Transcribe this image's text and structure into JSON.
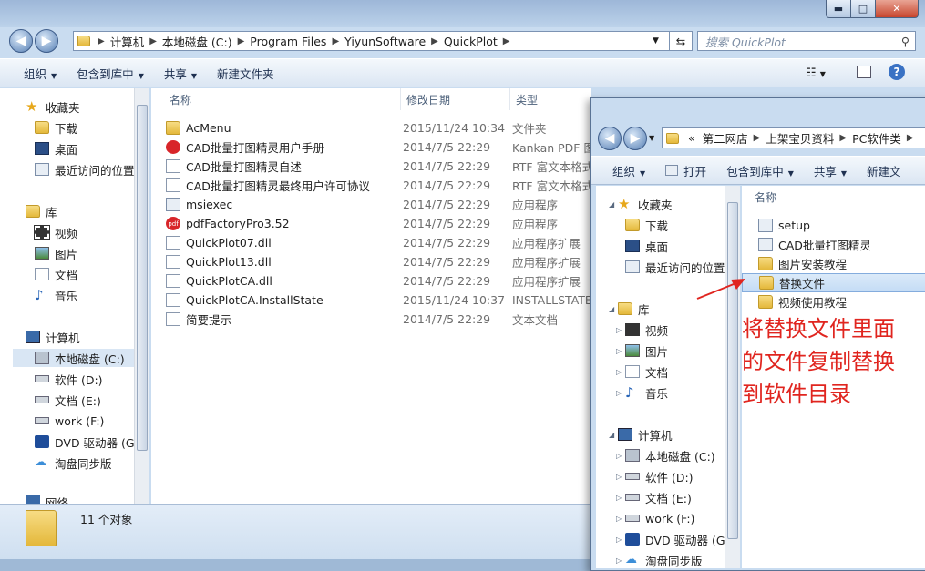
{
  "window1": {
    "title_controls": {
      "minimize": "▬",
      "maximize": "□",
      "close": "✕"
    },
    "address": [
      "计算机",
      "本地磁盘 (C:)",
      "Program Files",
      "YiyunSoftware",
      "QuickPlot"
    ],
    "search_placeholder": "搜索 QuickPlot",
    "toolbar": [
      "组织",
      "包含到库中",
      "共享",
      "新建文件夹"
    ],
    "nav": {
      "favorites": "收藏夹",
      "fav_items": [
        "下载",
        "桌面",
        "最近访问的位置"
      ],
      "library": "库",
      "lib_items": [
        "视频",
        "图片",
        "文档",
        "音乐"
      ],
      "computer": "计算机",
      "drives": [
        "本地磁盘 (C:)",
        "软件 (D:)",
        "文档 (E:)",
        "work (F:)",
        "DVD 驱动器 (G:)",
        "淘盘同步版"
      ],
      "network": "网络"
    },
    "columns": [
      "名称",
      "修改日期",
      "类型"
    ],
    "files": [
      {
        "name": "AcMenu",
        "date": "2015/11/24 10:34",
        "type": "文件夹",
        "icon": "folder"
      },
      {
        "name": "CAD批量打图精灵用户手册",
        "date": "2014/7/5 22:29",
        "type": "Kankan PDF 图",
        "icon": "pdf-doc"
      },
      {
        "name": "CAD批量打图精灵自述",
        "date": "2014/7/5 22:29",
        "type": "RTF 富文本格式",
        "icon": "rtf"
      },
      {
        "name": "CAD批量打图精灵最终用户许可协议",
        "date": "2014/7/5 22:29",
        "type": "RTF 富文本格式",
        "icon": "rtf"
      },
      {
        "name": "msiexec",
        "date": "2014/7/5 22:29",
        "type": "应用程序",
        "icon": "exe"
      },
      {
        "name": "pdfFactoryPro3.52",
        "date": "2014/7/5 22:29",
        "type": "应用程序",
        "icon": "pdf"
      },
      {
        "name": "QuickPlot07.dll",
        "date": "2014/7/5 22:29",
        "type": "应用程序扩展",
        "icon": "dll"
      },
      {
        "name": "QuickPlot13.dll",
        "date": "2014/7/5 22:29",
        "type": "应用程序扩展",
        "icon": "dll"
      },
      {
        "name": "QuickPlotCA.dll",
        "date": "2014/7/5 22:29",
        "type": "应用程序扩展",
        "icon": "dll"
      },
      {
        "name": "QuickPlotCA.InstallState",
        "date": "2015/11/24 10:37",
        "type": "INSTALLSTATE",
        "icon": "file"
      },
      {
        "name": "简要提示",
        "date": "2014/7/5 22:29",
        "type": "文本文档",
        "icon": "txt"
      }
    ],
    "status": "11 个对象"
  },
  "window2": {
    "address": [
      "第二网店",
      "上架宝贝资料",
      "PC软件类"
    ],
    "address_prefix": "«",
    "toolbar": [
      "组织",
      "打开",
      "包含到库中",
      "共享",
      "新建文"
    ],
    "nav": {
      "favorites": "收藏夹",
      "fav_items": [
        "下载",
        "桌面",
        "最近访问的位置"
      ],
      "library": "库",
      "lib_items": [
        "视频",
        "图片",
        "文档",
        "音乐"
      ],
      "computer": "计算机",
      "drives": [
        "本地磁盘 (C:)",
        "软件 (D:)",
        "文档 (E:)",
        "work (F:)",
        "DVD 驱动器 (G:)",
        "淘盘同步版"
      ]
    },
    "column": "名称",
    "files": [
      {
        "name": "setup",
        "icon": "setup"
      },
      {
        "name": "CAD批量打图精灵",
        "icon": "exe"
      },
      {
        "name": "图片安装教程",
        "icon": "folder"
      },
      {
        "name": "替换文件",
        "icon": "folder",
        "selected": true
      },
      {
        "name": "视频使用教程",
        "icon": "folder"
      }
    ]
  },
  "annotation": "将替换文件里面\n的文件复制替换\n到软件目录",
  "colors": {
    "annotation": "#e0251f",
    "selection": "#cfe3f7"
  }
}
